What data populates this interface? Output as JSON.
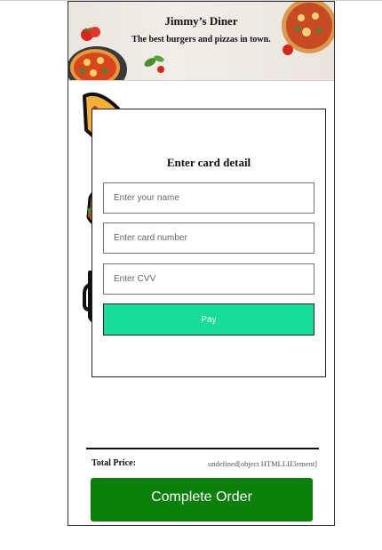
{
  "header": {
    "title": "Jimmy’s Diner",
    "tagline": "The best burgers and pizzas in town."
  },
  "payment_modal": {
    "title": "Enter card detail",
    "name_placeholder": "Enter your name",
    "card_placeholder": "Enter card number",
    "cvv_placeholder": "Enter CVV",
    "pay_label": "Pay"
  },
  "order": {
    "total_label": "Total Price:",
    "total_value": "undefined[object HTMLLIElement]",
    "complete_label": "Complete Order"
  },
  "colors": {
    "pay_button": "#16de9a",
    "complete_button": "#0a7f0a"
  },
  "icons": [
    "pizza-icon",
    "burger-icon",
    "beer-icon",
    "tomato-icon",
    "pizza-slice-icon"
  ]
}
